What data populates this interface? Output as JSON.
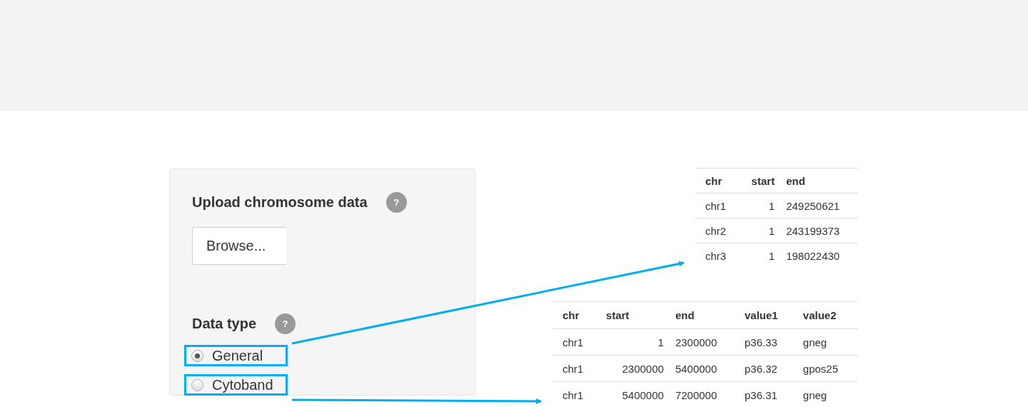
{
  "upload": {
    "label": "Upload chromosome data",
    "help": "?",
    "button": "Browse..."
  },
  "data_type": {
    "label": "Data type",
    "help": "?",
    "options": [
      {
        "label": "General",
        "selected": true,
        "highlighted": true
      },
      {
        "label": "Cytoband",
        "selected": false,
        "highlighted": true
      }
    ]
  },
  "general_table": {
    "columns": [
      "chr",
      "start",
      "end"
    ],
    "rows": [
      [
        "chr1",
        "1",
        "249250621"
      ],
      [
        "chr2",
        "1",
        "243199373"
      ],
      [
        "chr3",
        "1",
        "198022430"
      ]
    ]
  },
  "cytoband_table": {
    "columns": [
      "chr",
      "start",
      "end",
      "value1",
      "value2"
    ],
    "rows": [
      [
        "chr1",
        "1",
        "2300000",
        "p36.33",
        "gneg"
      ],
      [
        "chr1",
        "2300000",
        "5400000",
        "p36.32",
        "gpos25"
      ],
      [
        "chr1",
        "5400000",
        "7200000",
        "p36.31",
        "gneg"
      ]
    ]
  }
}
